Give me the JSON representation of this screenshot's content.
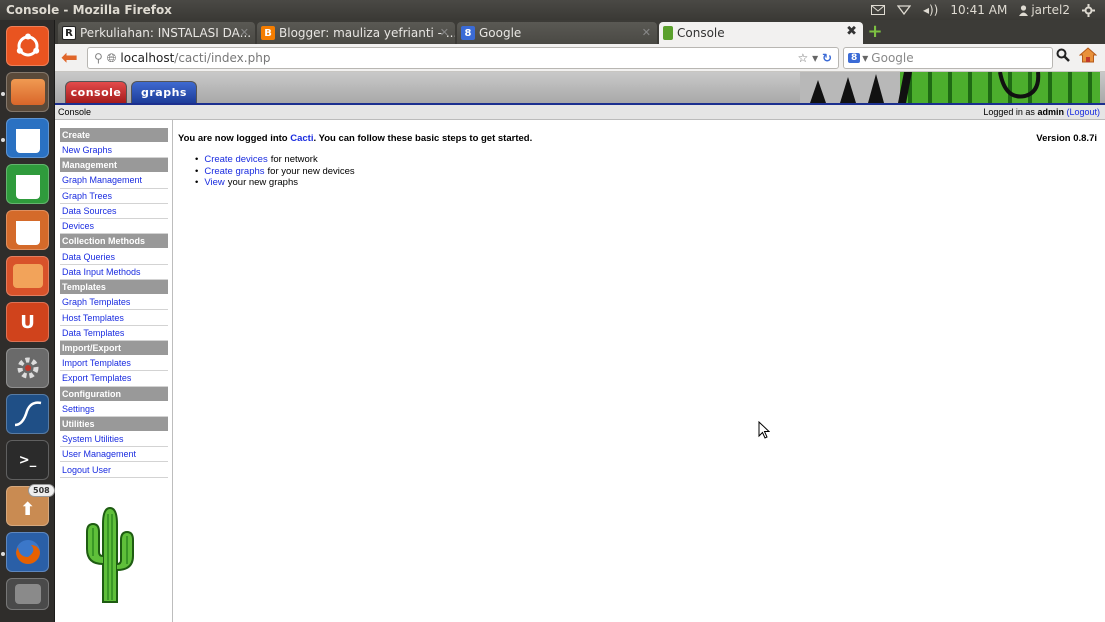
{
  "panel": {
    "window_title": "Console - Mozilla Firefox",
    "clock": "10:41 AM",
    "user": "jartel2"
  },
  "launcher": {
    "items": [
      {
        "name": "ubuntu-dash",
        "color": "#e95420"
      },
      {
        "name": "files",
        "color": "#e37b36"
      },
      {
        "name": "writer",
        "color": "#2a71c2"
      },
      {
        "name": "calc",
        "color": "#2f9b3c"
      },
      {
        "name": "impress",
        "color": "#d46a2a"
      },
      {
        "name": "software-center",
        "color": "#d8522a"
      },
      {
        "name": "ubuntu-one",
        "color": "#d0431c"
      },
      {
        "name": "system-settings",
        "color": "#c0392b"
      },
      {
        "name": "wireshark",
        "color": "#2d6aa7"
      },
      {
        "name": "terminal",
        "color": "#333333"
      },
      {
        "name": "update-manager",
        "color": "#d9893b"
      },
      {
        "name": "firefox",
        "color": "#e66000"
      },
      {
        "name": "workspace-switcher",
        "color": "#6b6b6b"
      }
    ],
    "update_badge": "508"
  },
  "browser": {
    "tabs": [
      {
        "label": "Perkuliahan: INSTALASI DA...",
        "fav": "R",
        "fav_color": "#222222",
        "active": false
      },
      {
        "label": "Blogger: mauliza yefrianti - ...",
        "fav": "B",
        "fav_color": "#f57d00",
        "active": false
      },
      {
        "label": "Google",
        "fav": "8",
        "fav_color": "#3b6bd6",
        "active": false
      },
      {
        "label": "Console",
        "fav": "",
        "fav_color": "#5aa02c",
        "active": true
      }
    ],
    "url_host": "localhost",
    "url_path": "/cacti/index.php",
    "search_placeholder": "Google"
  },
  "cacti": {
    "tab_console": "console",
    "tab_graphs": "graphs",
    "breadcrumb": "Console",
    "login_prefix": "Logged in as",
    "login_user": "admin",
    "logout_link": "(Logout)",
    "menu": [
      {
        "type": "head",
        "label": "Create"
      },
      {
        "type": "item",
        "label": "New Graphs"
      },
      {
        "type": "head",
        "label": "Management"
      },
      {
        "type": "item",
        "label": "Graph Management"
      },
      {
        "type": "item",
        "label": "Graph Trees"
      },
      {
        "type": "item",
        "label": "Data Sources"
      },
      {
        "type": "item",
        "label": "Devices"
      },
      {
        "type": "head",
        "label": "Collection Methods"
      },
      {
        "type": "item",
        "label": "Data Queries"
      },
      {
        "type": "item",
        "label": "Data Input Methods"
      },
      {
        "type": "head",
        "label": "Templates"
      },
      {
        "type": "item",
        "label": "Graph Templates"
      },
      {
        "type": "item",
        "label": "Host Templates"
      },
      {
        "type": "item",
        "label": "Data Templates"
      },
      {
        "type": "head",
        "label": "Import/Export"
      },
      {
        "type": "item",
        "label": "Import Templates"
      },
      {
        "type": "item",
        "label": "Export Templates"
      },
      {
        "type": "head",
        "label": "Configuration"
      },
      {
        "type": "item",
        "label": "Settings"
      },
      {
        "type": "head",
        "label": "Utilities"
      },
      {
        "type": "item",
        "label": "System Utilities"
      },
      {
        "type": "item",
        "label": "User Management"
      },
      {
        "type": "item",
        "label": "Logout User"
      }
    ],
    "welcome_pre": "You are now logged into",
    "welcome_link": "Cacti",
    "welcome_post": ". You can follow these basic steps to get started.",
    "version": "Version 0.8.7i",
    "steps": [
      {
        "link": "Create devices",
        "text": "for network"
      },
      {
        "link": "Create graphs",
        "text": "for your new devices"
      },
      {
        "link": "View",
        "text": "your new graphs"
      }
    ]
  }
}
